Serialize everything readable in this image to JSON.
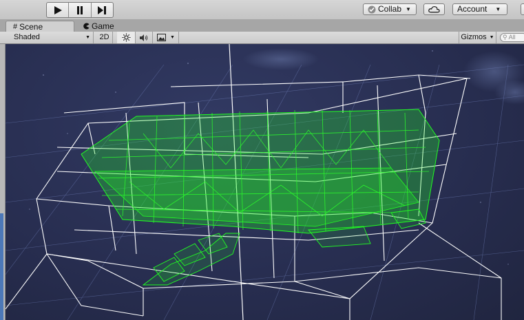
{
  "toolbar": {
    "collab_label": "Collab",
    "account_label": "Account"
  },
  "tabs": [
    {
      "label": "Scene",
      "active": true
    },
    {
      "label": "Game",
      "active": false
    }
  ],
  "scene_toolbar": {
    "shading_mode": "Shaded",
    "mode_2d_label": "2D",
    "gizmos_label": "Gizmos",
    "search_placeholder": "All"
  },
  "icons": {
    "play": "play-icon",
    "pause": "pause-icon",
    "step": "step-icon",
    "collab_check": "check-circle-icon",
    "cloud": "cloud-icon",
    "scene_tab": "grid-icon",
    "game_tab": "pacman-icon",
    "lighting": "sun-icon",
    "audio": "speaker-icon",
    "effects": "image-icon",
    "search": "search-icon"
  },
  "colors": {
    "scene_background": "#272d4f",
    "wireframe_white": "#ffffff",
    "wireframe_green": "#22ff22"
  }
}
